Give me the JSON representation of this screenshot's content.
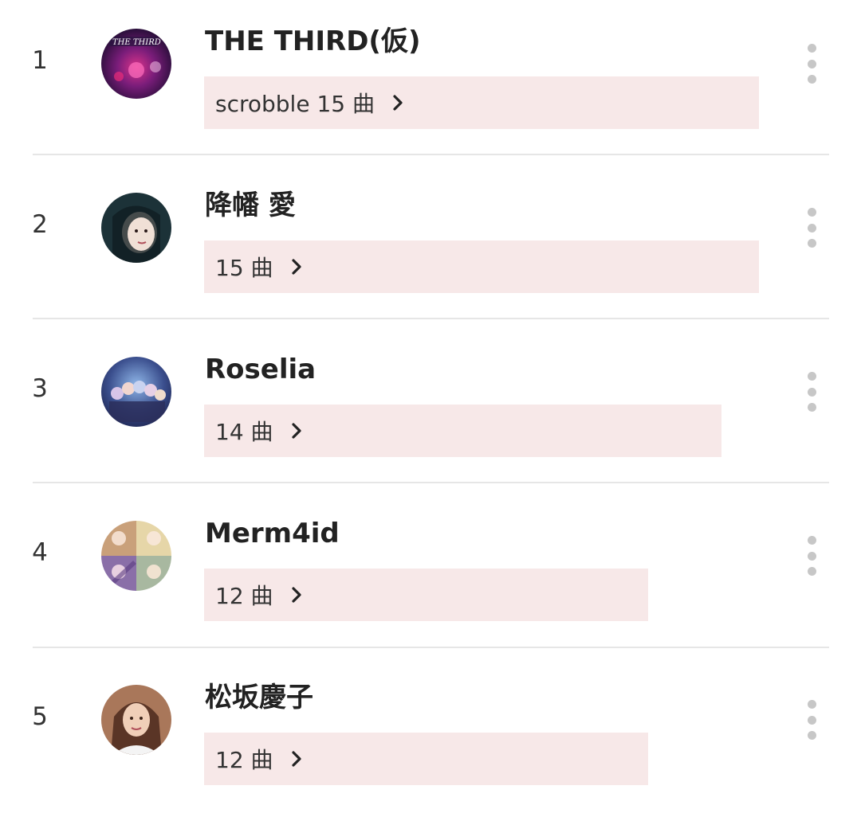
{
  "artists": [
    {
      "rank": "1",
      "name": "THE THIRD(仮)",
      "count_label": "scrobble 15 曲",
      "count": 15,
      "avatar_icon": "band-live-photo-avatar"
    },
    {
      "rank": "2",
      "name": "降幡 愛",
      "count_label": "15 曲",
      "count": 15,
      "avatar_icon": "portrait-photo-avatar"
    },
    {
      "rank": "3",
      "name": "Roselia",
      "count_label": "14 曲",
      "count": 14,
      "avatar_icon": "group-artwork-avatar"
    },
    {
      "rank": "4",
      "name": "Merm4id",
      "count_label": "12 曲",
      "count": 12,
      "avatar_icon": "group-artwork-avatar"
    },
    {
      "rank": "5",
      "name": "松坂慶子",
      "count_label": "12 曲",
      "count": 12,
      "avatar_icon": "portrait-photo-avatar"
    }
  ],
  "icons": {
    "chevron": "chevron-right-icon",
    "more": "more-vertical-icon"
  },
  "colors": {
    "bar_background": "#f7e8e8",
    "divider": "#e6e6e6",
    "dots": "#c7c7c7",
    "text": "#222222"
  }
}
